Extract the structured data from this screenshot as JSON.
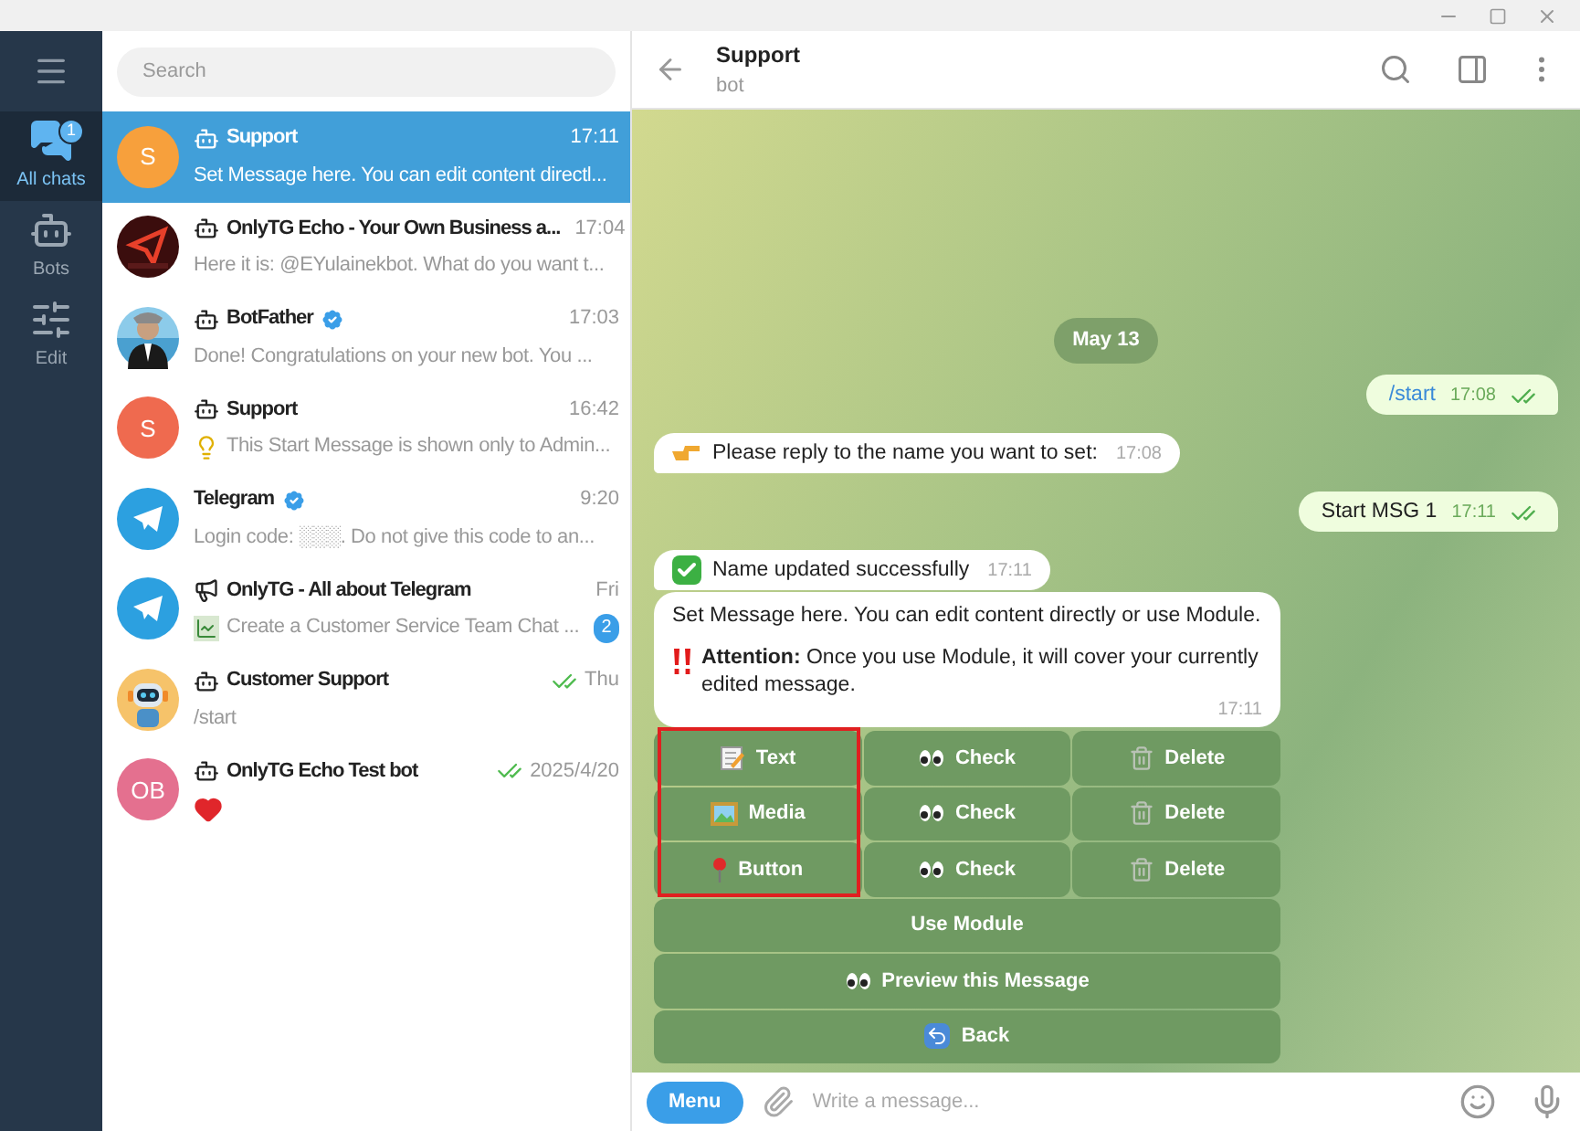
{
  "sidebar": {
    "items": [
      {
        "label": "All chats",
        "kind": "chats",
        "selected": true,
        "badge": "1"
      },
      {
        "label": "Bots",
        "kind": "bots",
        "selected": false
      },
      {
        "label": "Edit",
        "kind": "edit",
        "selected": false
      }
    ]
  },
  "search": {
    "placeholder": "Search"
  },
  "chats": [
    {
      "name": "Support",
      "kind": "bot",
      "avatar": {
        "kind": "letter",
        "text": "S",
        "color": "#f7a03c"
      },
      "time": "17:11",
      "preview": "Set Message here. You can edit content directl...",
      "selected": true,
      "verified": false,
      "read": false
    },
    {
      "name": "OnlyTG Echo - Your Own Business a...",
      "kind": "bot",
      "avatar": {
        "kind": "echo"
      },
      "time": "17:04",
      "preview": "Here it is: @EYulainekbot. What do you want t...",
      "selected": false,
      "verified": false,
      "read": false
    },
    {
      "name": "BotFather",
      "kind": "bot",
      "time": "17:03",
      "preview": "Done! Congratulations on your new bot. You ...",
      "selected": false,
      "verified": true,
      "read": false
    },
    {
      "name": "Support",
      "kind": "bot",
      "avatar": {
        "kind": "letter",
        "text": "S",
        "color": "#ef6a4f"
      },
      "time": "16:42",
      "preview": "This Start Message is shown only to Admin...",
      "prefix": {
        "kind": "bulb"
      },
      "selected": false,
      "verified": false,
      "read": false
    },
    {
      "name": "Telegram",
      "kind": "user",
      "avatar": {
        "kind": "plane"
      },
      "time": "9:20",
      "preview": "Login code: ░░░. Do not give this code to an...",
      "selected": false,
      "verified": true,
      "read": false
    },
    {
      "name": "OnlyTG - All about Telegram",
      "kind": "channel",
      "avatar": {
        "kind": "plane"
      },
      "time": "Fri",
      "preview": "Create a Customer Service Team Chat ...",
      "prefix": {
        "kind": "chart"
      },
      "unread": "2",
      "selected": false,
      "verified": false,
      "read": false
    },
    {
      "name": "Customer Support",
      "kind": "bot",
      "avatar": {
        "kind": "robot"
      },
      "time": "Thu",
      "preview": "/start",
      "selected": false,
      "verified": false,
      "read": true
    },
    {
      "name": "OnlyTG Echo Test bot",
      "kind": "bot",
      "avatar": {
        "kind": "letter",
        "text": "OB",
        "color": "#e4708f"
      },
      "time": "2025/4/20",
      "prefix": {
        "kind": "heart"
      },
      "selected": false,
      "verified": false,
      "read": true
    }
  ],
  "chat": {
    "title": "Support",
    "subtitle": "bot",
    "date": "May 13",
    "messages": [
      {
        "kind": "out",
        "text": "/start",
        "time": "17:08",
        "link": true,
        "read": true
      },
      {
        "kind": "in",
        "prefix": {
          "kind": "point"
        },
        "text": "Please reply to the name you want to set:",
        "time": "17:08"
      },
      {
        "kind": "out",
        "text": "Start MSG 1",
        "time": "17:11",
        "link": false,
        "read": true
      },
      {
        "kind": "in",
        "prefix": {
          "kind": "check"
        },
        "text": "Name updated successfully",
        "time": "17:11"
      },
      {
        "kind": "long",
        "paragraphs": [
          {
            "text": "Set Message here. You can edit content directly or use Module."
          },
          {
            "prefix": {
              "kind": "alert"
            },
            "text": "**Attention:** Once you use Module, it will cover your currently edited message."
          }
        ],
        "time": "17:11"
      }
    ],
    "keyboard": {
      "highlight_first_column": true,
      "rows": [
        [
          {
            "label": "Text",
            "kind": "memo"
          },
          {
            "label": "Check",
            "kind": "eyes"
          },
          {
            "label": "Delete",
            "kind": "trash"
          }
        ],
        [
          {
            "label": "Media",
            "kind": "media"
          },
          {
            "label": "Check",
            "kind": "eyes"
          },
          {
            "label": "Delete",
            "kind": "trash"
          }
        ],
        [
          {
            "label": "Button",
            "kind": "pin"
          },
          {
            "label": "Check",
            "kind": "eyes"
          },
          {
            "label": "Delete",
            "kind": "trash"
          }
        ],
        [
          {
            "label": "Use Module",
            "kind": "plain"
          }
        ],
        [
          {
            "label": "Preview this Message",
            "kind": "eyes"
          }
        ],
        [
          {
            "label": "Back",
            "kind": "back"
          }
        ]
      ]
    }
  },
  "composer": {
    "menu": "Menu",
    "placeholder": "Write a message..."
  }
}
